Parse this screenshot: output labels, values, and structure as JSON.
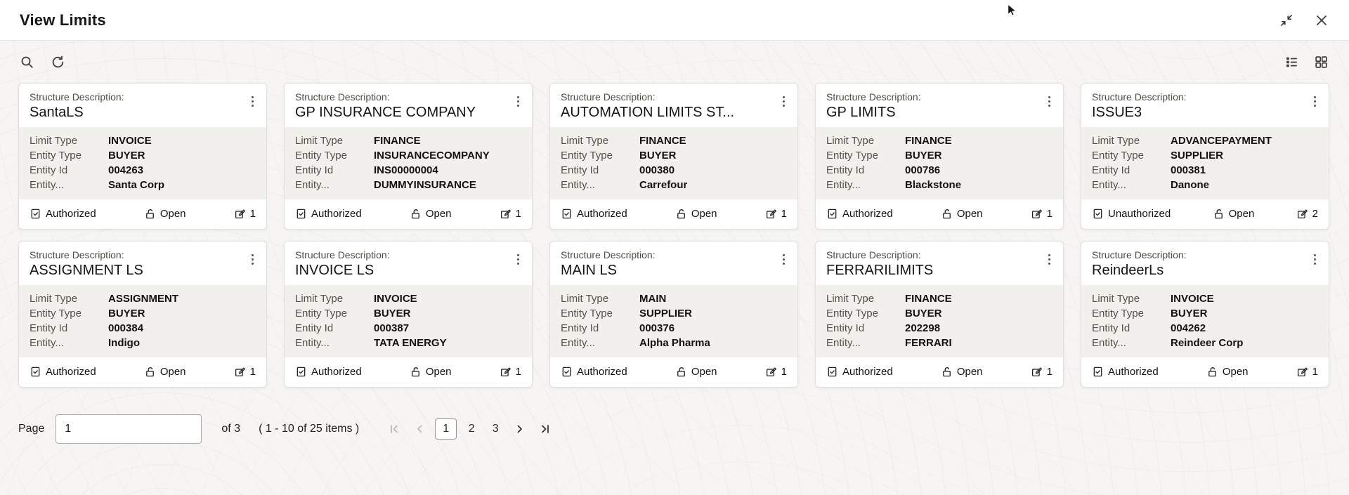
{
  "window": {
    "title": "View Limits"
  },
  "icons": {
    "header": [
      "collapse-icon",
      "close-icon"
    ],
    "toolbar_left": [
      "search-icon",
      "refresh-icon"
    ],
    "toolbar_right": [
      "list-view-icon",
      "grid-view-icon"
    ],
    "card": [
      "kebab-menu-icon",
      "authorized-icon",
      "open-lock-icon",
      "edit-icon"
    ]
  },
  "card_labels": {
    "structure_description": "Structure Description:",
    "limit_type": "Limit Type",
    "entity_type": "Entity Type",
    "entity_id": "Entity Id",
    "entity": "Entity...",
    "open": "Open"
  },
  "cards": [
    {
      "name": "SantaLS",
      "limit_type": "INVOICE",
      "entity_type": "BUYER",
      "entity_id": "004263",
      "entity": "Santa Corp",
      "status": "Authorized",
      "edit_count": "1"
    },
    {
      "name": "GP INSURANCE COMPANY",
      "limit_type": "FINANCE",
      "entity_type": "INSURANCECOMPANY",
      "entity_id": "INS00000004",
      "entity": "DUMMYINSURANCE",
      "status": "Authorized",
      "edit_count": "1"
    },
    {
      "name": "AUTOMATION LIMITS ST...",
      "limit_type": "FINANCE",
      "entity_type": "BUYER",
      "entity_id": "000380",
      "entity": "Carrefour",
      "status": "Authorized",
      "edit_count": "1"
    },
    {
      "name": "GP LIMITS",
      "limit_type": "FINANCE",
      "entity_type": "BUYER",
      "entity_id": "000786",
      "entity": "Blackstone",
      "status": "Authorized",
      "edit_count": "1"
    },
    {
      "name": "ISSUE3",
      "limit_type": "ADVANCEPAYMENT",
      "entity_type": "SUPPLIER",
      "entity_id": "000381",
      "entity": "Danone",
      "status": "Unauthorized",
      "edit_count": "2"
    },
    {
      "name": "ASSIGNMENT LS",
      "limit_type": "ASSIGNMENT",
      "entity_type": "BUYER",
      "entity_id": "000384",
      "entity": "Indigo",
      "status": "Authorized",
      "edit_count": "1"
    },
    {
      "name": "INVOICE LS",
      "limit_type": "INVOICE",
      "entity_type": "BUYER",
      "entity_id": "000387",
      "entity": "TATA ENERGY",
      "status": "Authorized",
      "edit_count": "1"
    },
    {
      "name": "MAIN LS",
      "limit_type": "MAIN",
      "entity_type": "SUPPLIER",
      "entity_id": "000376",
      "entity": "Alpha Pharma",
      "status": "Authorized",
      "edit_count": "1"
    },
    {
      "name": "FERRARILIMITS",
      "limit_type": "FINANCE",
      "entity_type": "BUYER",
      "entity_id": "202298",
      "entity": "FERRARI",
      "status": "Authorized",
      "edit_count": "1"
    },
    {
      "name": "ReindeerLs",
      "limit_type": "INVOICE",
      "entity_type": "BUYER",
      "entity_id": "004262",
      "entity": "Reindeer Corp",
      "status": "Authorized",
      "edit_count": "1"
    }
  ],
  "pagination": {
    "page_label": "Page",
    "page_value": "1",
    "of_text": "of 3",
    "items_text": "( 1 - 10 of 25 items )",
    "pages": [
      "1",
      "2",
      "3"
    ],
    "current_page": "1"
  }
}
